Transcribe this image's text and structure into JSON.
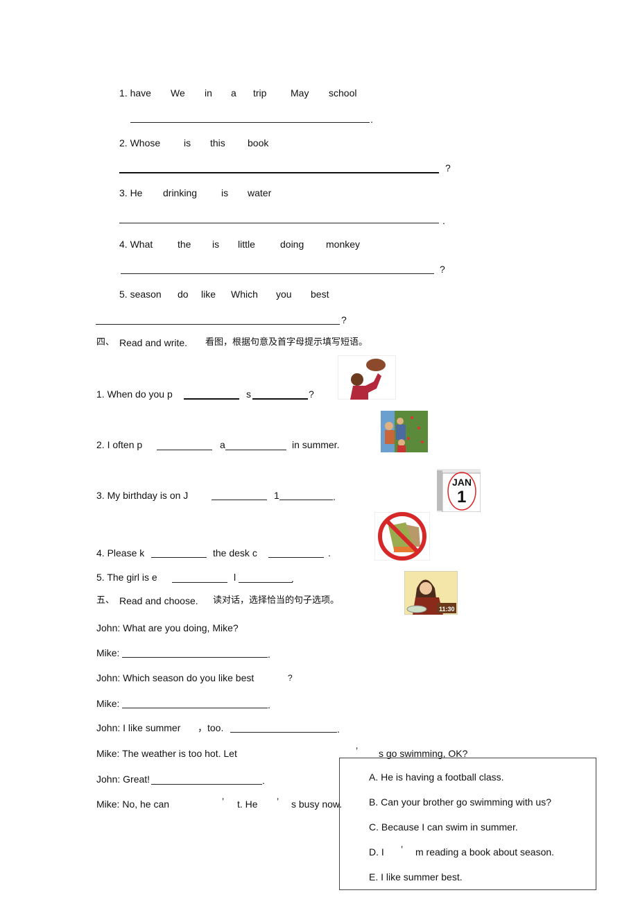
{
  "section3": {
    "q1": {
      "words": [
        "1. have",
        "We",
        "in",
        "a",
        "trip",
        "May",
        "school"
      ],
      "end": "."
    },
    "q2": {
      "words": [
        "2. Whose",
        "is",
        "this",
        "book"
      ],
      "end": "?"
    },
    "q3": {
      "words": [
        "3. He",
        "drinking",
        "is",
        "water"
      ],
      "end": "."
    },
    "q4": {
      "words": [
        "4. What",
        "the",
        "is",
        "little",
        "doing",
        "monkey"
      ],
      "end": "?"
    },
    "q5": {
      "words": [
        "5. season",
        "do",
        "like",
        "Which",
        "you",
        "best"
      ],
      "end": "?"
    }
  },
  "section4": {
    "num": "四、",
    "title": "Read and write.",
    "instruction": "看图，根据句意及首字母提示填写短语。",
    "items": [
      {
        "parts": [
          "1. When do you p",
          "s",
          "?"
        ],
        "image": "boy-playing-basketball"
      },
      {
        "parts": [
          "2. I often p",
          "a",
          "in summer."
        ],
        "image": "family-picking-apples"
      },
      {
        "parts": [
          "3. My birthday is on J",
          "1",
          "."
        ],
        "image": "calendar-jan-1",
        "calendar": {
          "month": "JAN",
          "day": "1"
        }
      },
      {
        "parts": [
          "4. Please k",
          "the desk c",
          "."
        ],
        "image": "no-messy-desk-sign"
      },
      {
        "parts": [
          "5. The girl is e",
          "l",
          "."
        ],
        "image": "girl-eating-lunch",
        "clock": "11:30"
      }
    ]
  },
  "section5": {
    "num": "五、",
    "title": "Read and choose.",
    "instruction": "读对话，选择恰当的句子选项。",
    "dialogue": [
      "John: What are you doing, Mike?",
      "Mike:",
      "John: Which season do you like best",
      "Mike:",
      "John: I like summer",
      "Mike: The weather is too hot. Let",
      "John: Great!",
      "Mike: No, he can"
    ],
    "fragments": {
      "q3_mark": "?",
      "line5_b": "，too.",
      "line6_b": "’",
      "line6_c": "s go swimming, OK?",
      "line8_b": "’",
      "line8_c": "t. He",
      "line8_d": "’",
      "line8_e": "s busy now.",
      "dot": "."
    },
    "options": [
      "A. He is having a football class.",
      "B. Can your brother go swimming with us?",
      "C. Because I can swim in summer.",
      "D. I",
      "E. I like summer best."
    ],
    "option_d_rest": [
      "’",
      "m reading a book about season."
    ]
  }
}
